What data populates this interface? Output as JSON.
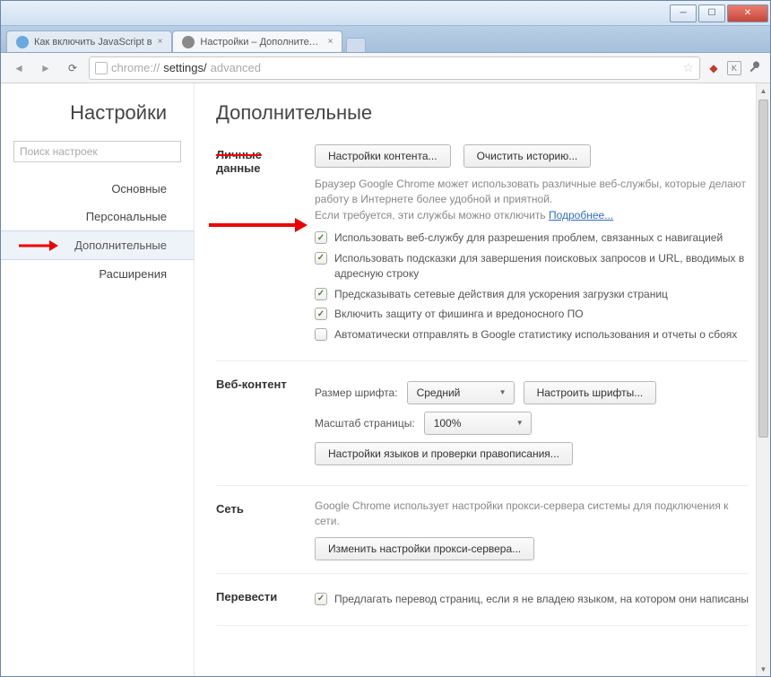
{
  "window": {
    "minimize": "─",
    "maximize": "☐",
    "close": "✕"
  },
  "tabs": {
    "t0": "Как включить JavaScript в",
    "t1": "Настройки – Дополнительн"
  },
  "toolbar": {
    "back": "◄",
    "forward": "►",
    "reload": "⟳",
    "url_scheme": "chrome://",
    "url_path1": "settings/",
    "url_path2": "advanced",
    "star": "☆",
    "k_badge": "K",
    "wrench": "✦"
  },
  "sidebar": {
    "title": "Настройки",
    "search_placeholder": "Поиск настроек",
    "items": {
      "basic": "Основные",
      "personal": "Персональные",
      "advanced": "Дополнительные",
      "extensions": "Расширения"
    }
  },
  "main": {
    "title": "Дополнительные"
  },
  "privacy": {
    "label_struck": "Личные",
    "label_plain": "данные",
    "btn_content": "Настройки контента...",
    "btn_clear": "Очистить историю...",
    "desc1": "Браузер Google Chrome может использовать различные веб-службы, которые делают работу в Интернете более удобной и приятной.",
    "desc2_a": "Если требуется, эти службы можно отключить ",
    "more_link": "Подробнее...",
    "chk_nav": "Использовать веб-службу для разрешения проблем, связанных с навигацией",
    "chk_suggest": "Использовать подсказки для завершения поисковых запросов и URL, вводимых в адресную строку",
    "chk_predict": "Предсказывать сетевые действия для ускорения загрузки страниц",
    "chk_phishing": "Включить защиту от фишинга и вредоносного ПО",
    "chk_crash": "Автоматически отправлять в Google статистику использования и отчеты о сбоях"
  },
  "web": {
    "label": "Веб-контент",
    "font_label": "Размер шрифта:",
    "font_value": "Средний",
    "btn_fonts": "Настроить шрифты...",
    "zoom_label": "Масштаб страницы:",
    "zoom_value": "100%",
    "btn_lang": "Настройки языков и проверки правописания..."
  },
  "net": {
    "label": "Сеть",
    "desc": "Google Chrome использует настройки прокси-сервера системы для подключения к сети.",
    "btn_proxy": "Изменить настройки прокси-сервера..."
  },
  "trans": {
    "label": "Перевести",
    "chk_translate": "Предлагать перевод страниц, если я не владею языком, на котором они написаны"
  }
}
